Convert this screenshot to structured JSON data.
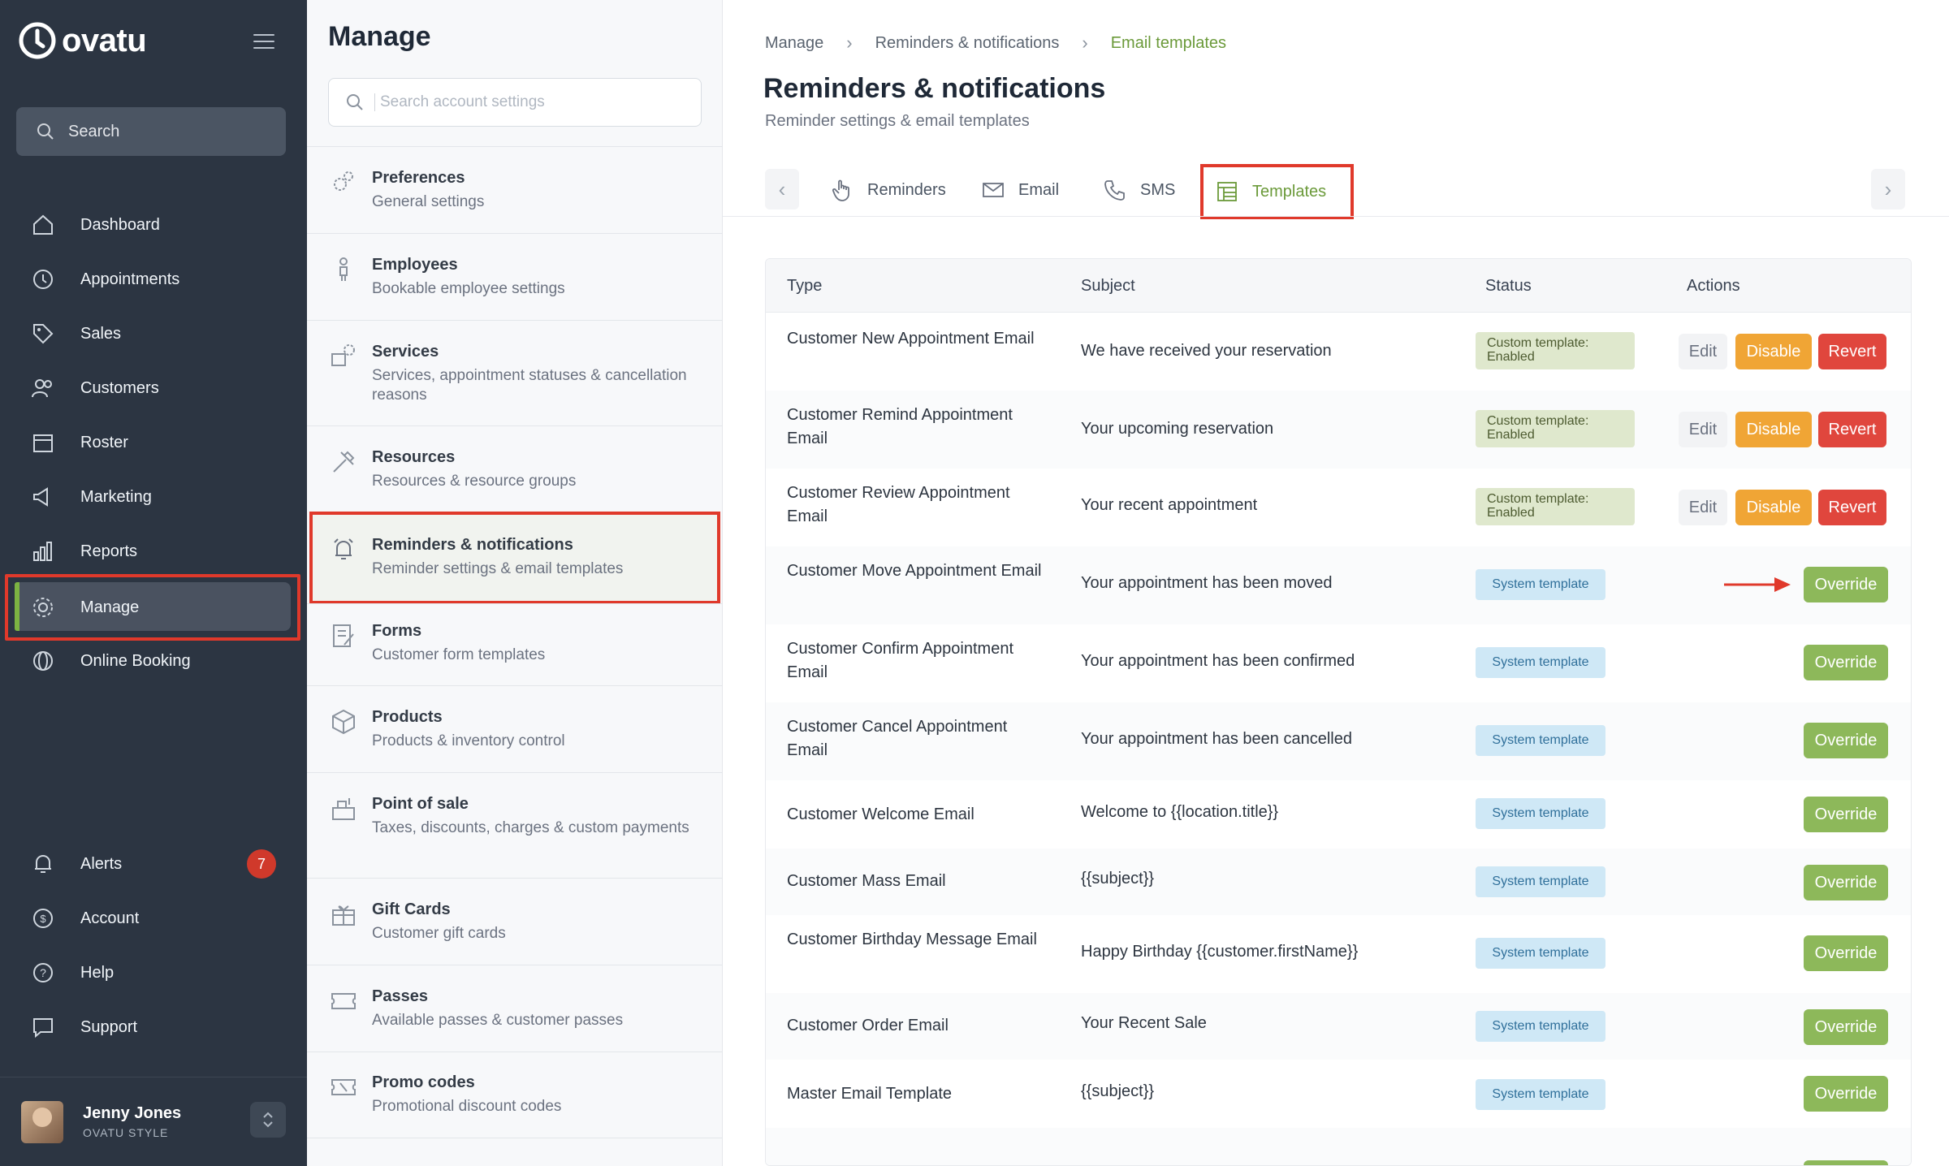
{
  "brand": {
    "name": "ovatu"
  },
  "sidebar": {
    "search_label": "Search",
    "items": [
      {
        "label": "Dashboard",
        "icon": "home-icon"
      },
      {
        "label": "Appointments",
        "icon": "clock-icon"
      },
      {
        "label": "Sales",
        "icon": "tag-icon"
      },
      {
        "label": "Customers",
        "icon": "users-icon"
      },
      {
        "label": "Roster",
        "icon": "calendar-icon"
      },
      {
        "label": "Marketing",
        "icon": "megaphone-icon"
      },
      {
        "label": "Reports",
        "icon": "chart-icon"
      },
      {
        "label": "Manage",
        "icon": "gear-icon"
      },
      {
        "label": "Online Booking",
        "icon": "globe-icon"
      }
    ],
    "bottom_items": [
      {
        "label": "Alerts",
        "icon": "bell-icon",
        "badge": "7"
      },
      {
        "label": "Account",
        "icon": "account-icon"
      },
      {
        "label": "Help",
        "icon": "help-icon"
      },
      {
        "label": "Support",
        "icon": "chat-icon"
      }
    ],
    "user": {
      "name": "Jenny Jones",
      "org": "OVATU STYLE"
    }
  },
  "manage": {
    "title": "Manage",
    "search_placeholder": "Search account settings",
    "items": [
      {
        "title": "Preferences",
        "desc": "General settings"
      },
      {
        "title": "Employees",
        "desc": "Bookable employee settings"
      },
      {
        "title": "Services",
        "desc": "Services, appointment statuses & cancellation reasons"
      },
      {
        "title": "Resources",
        "desc": "Resources & resource groups"
      },
      {
        "title": "Reminders & notifications",
        "desc": "Reminder settings & email templates"
      },
      {
        "title": "Forms",
        "desc": "Customer form templates"
      },
      {
        "title": "Products",
        "desc": "Products & inventory control"
      },
      {
        "title": "Point of sale",
        "desc": "Taxes, discounts, charges & custom payments"
      },
      {
        "title": "Gift Cards",
        "desc": "Customer gift cards"
      },
      {
        "title": "Passes",
        "desc": "Available passes & customer passes"
      },
      {
        "title": "Promo codes",
        "desc": "Promotional discount codes"
      }
    ]
  },
  "main": {
    "breadcrumb": [
      "Manage",
      "Reminders & notifications",
      "Email templates"
    ],
    "title": "Reminders & notifications",
    "subtitle": "Reminder settings & email templates",
    "tabs": [
      {
        "label": "Reminders",
        "icon": "hand-icon"
      },
      {
        "label": "Email",
        "icon": "envelope-icon"
      },
      {
        "label": "SMS",
        "icon": "phone-icon"
      },
      {
        "label": "Templates",
        "icon": "template-icon"
      }
    ],
    "table": {
      "headers": [
        "Type",
        "Subject",
        "Status",
        "Actions"
      ],
      "rows": [
        {
          "type": "Customer New Appointment Email",
          "subject": "We have received your reservation",
          "status": "Custom template: Enabled"
        },
        {
          "type": "Customer Remind Appointment Email",
          "subject": "Your upcoming reservation",
          "status": "Custom template: Enabled"
        },
        {
          "type": "Customer Review Appointment Email",
          "subject": "Your recent appointment",
          "status": "Custom template: Enabled"
        },
        {
          "type": "Customer Move Appointment Email",
          "subject": "Your appointment has been moved",
          "status": "System template"
        },
        {
          "type": "Customer Confirm Appointment Email",
          "subject": "Your appointment has been confirmed",
          "status": "System template"
        },
        {
          "type": "Customer Cancel Appointment Email",
          "subject": "Your appointment has been cancelled",
          "status": "System template"
        },
        {
          "type": "Customer Welcome Email",
          "subject": "Welcome to {{location.title}}",
          "status": "System template"
        },
        {
          "type": "Customer Mass Email",
          "subject": "{{subject}}",
          "status": "System template"
        },
        {
          "type": "Customer Birthday Message Email",
          "subject": "Happy Birthday {{customer.firstName}}",
          "status": "System template"
        },
        {
          "type": "Customer Order Email",
          "subject": "Your Recent Sale",
          "status": "System template"
        },
        {
          "type": "Master Email Template",
          "subject": "{{subject}}",
          "status": "System template"
        }
      ],
      "actions": {
        "edit": "Edit",
        "disable": "Disable",
        "revert": "Revert",
        "override": "Override"
      }
    }
  },
  "colors": {
    "accent_green": "#6b9a3a",
    "highlight_red": "#e0392b",
    "sidebar_bg": "#2c3542"
  }
}
